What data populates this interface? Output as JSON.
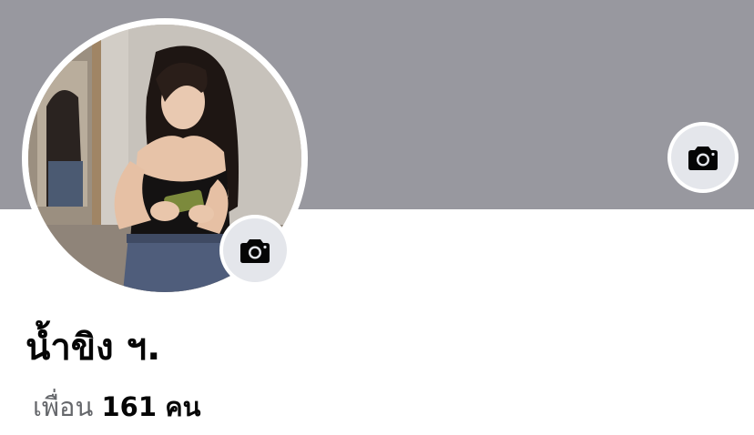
{
  "profile": {
    "name": "น้ำขิง ฯ.",
    "friends_label": "เพื่อน",
    "friends_count": "161",
    "friends_unit": "คน"
  },
  "icons": {
    "cover_camera": "camera-icon",
    "avatar_camera": "camera-icon",
    "avatar_photo": "profile-photo"
  },
  "colors": {
    "cover_background": "#98989f",
    "camera_button_background": "#e4e6eb",
    "secondary_text": "#65676b",
    "primary_text": "#050505"
  }
}
